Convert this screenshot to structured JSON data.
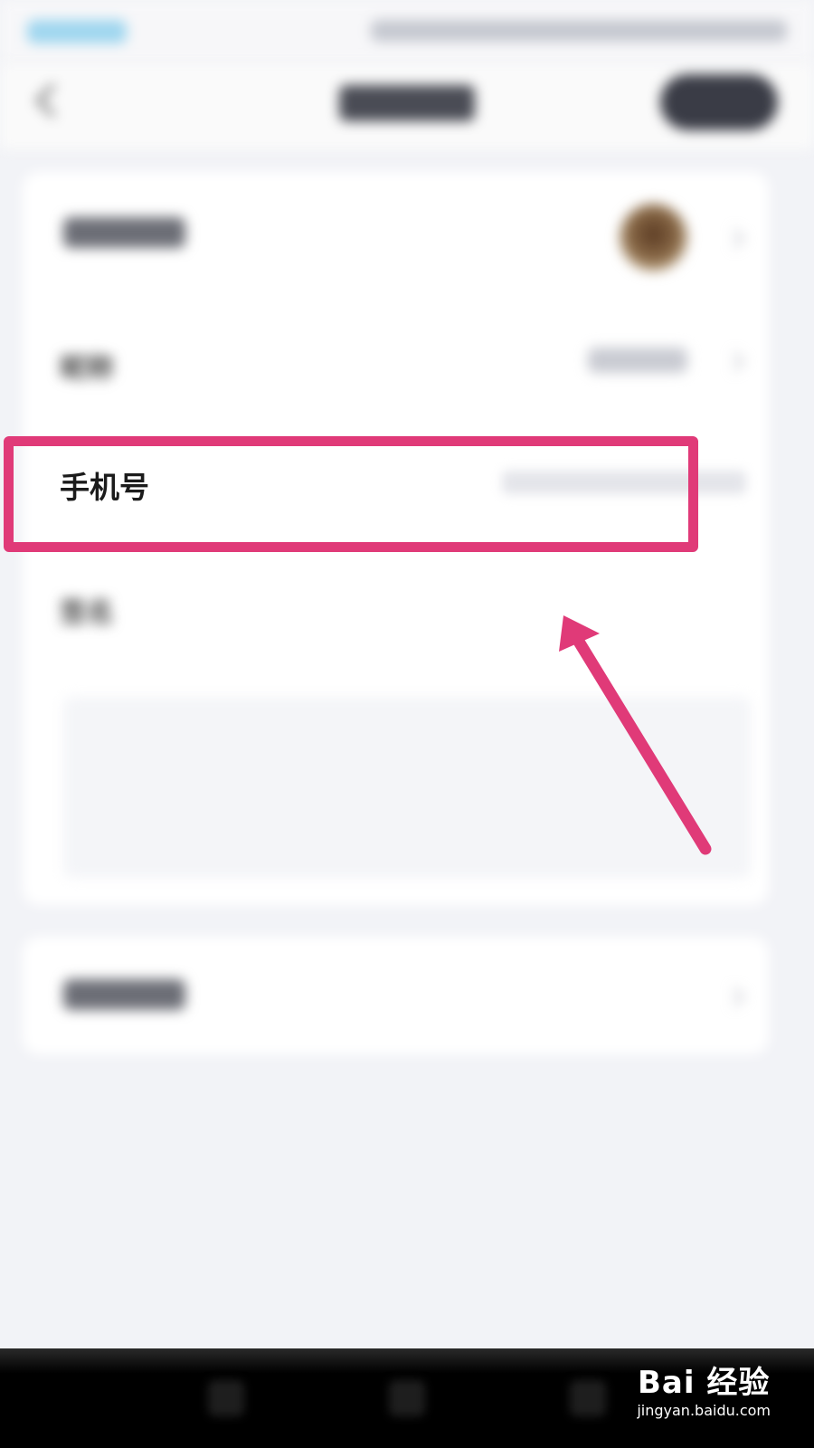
{
  "rows": {
    "nickname_label": "昵称",
    "phone_label": "手机号",
    "signature_label": "签名"
  },
  "watermark": {
    "brand": "Bai 经验",
    "url": "jingyan.baidu.com"
  },
  "colors": {
    "highlight": "#e03a78",
    "background": "#f2f3f7"
  },
  "icons": [
    "back-icon",
    "chevron-right-icon",
    "arrow-icon",
    "paw-icon"
  ]
}
